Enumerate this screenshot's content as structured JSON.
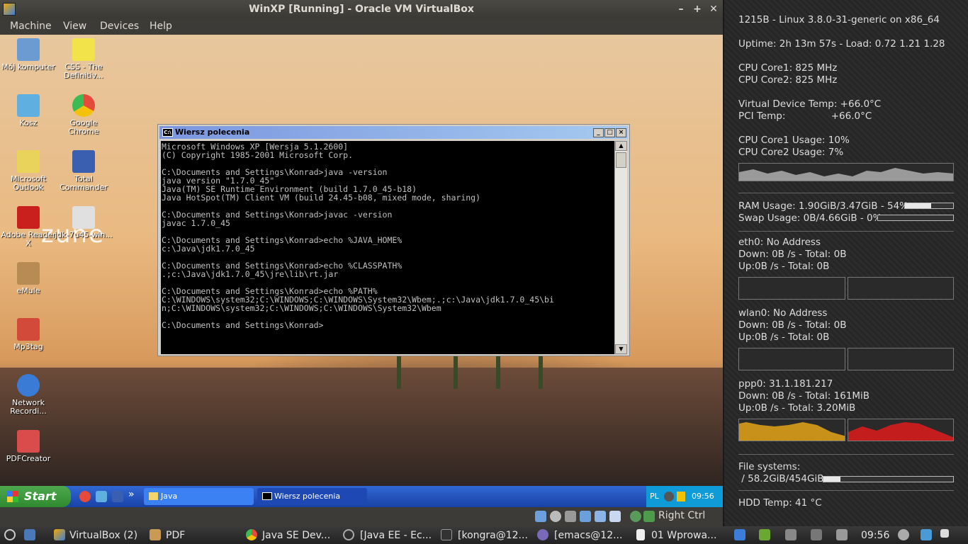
{
  "vbox": {
    "title": "WinXP [Running] - Oracle VM VirtualBox",
    "menu": [
      "Machine",
      "View",
      "Devices",
      "Help"
    ],
    "controls": {
      "minimize": "–",
      "maximize": "+",
      "close": "✕"
    },
    "status_hostkey": "Right Ctrl"
  },
  "guest": {
    "wallpaper_logo": "zune",
    "desktop_icons": [
      {
        "label": "Mój komputer",
        "icon": "my-computer-icon",
        "color": "#6c9bd2"
      },
      {
        "label": "CSS - The Definitiv...",
        "icon": "help-file-icon",
        "color": "#f2e34b"
      },
      {
        "label": "Kosz",
        "icon": "recycle-bin-icon",
        "color": "#5fb0e0"
      },
      {
        "label": "Google Chrome",
        "icon": "chrome-icon",
        "color": "#e64a3b"
      },
      {
        "label": "Microsoft Outlook",
        "icon": "outlook-icon",
        "color": "#e9d35a"
      },
      {
        "label": "Total Commander",
        "icon": "floppy-icon",
        "color": "#3a5fb0"
      },
      {
        "label": "Adobe Reader X",
        "icon": "adobe-reader-icon",
        "color": "#c9201d"
      },
      {
        "label": "jdk-7u45-win...",
        "icon": "java-icon",
        "color": "#e0e0e0"
      },
      {
        "label": "eMule",
        "icon": "emule-icon",
        "color": "#b88a54"
      },
      {
        "label": "Mp3tag",
        "icon": "mp3tag-icon",
        "color": "#d24a3a"
      },
      {
        "label": "Network Recordi...",
        "icon": "network-recorder-icon",
        "color": "#3a7bd5"
      },
      {
        "label": "PDFCreator",
        "icon": "pdfcreator-icon",
        "color": "#d94c4c"
      }
    ],
    "cmd": {
      "title": "Wiersz polecenia",
      "icon_text": "C:\\",
      "lines": [
        "Microsoft Windows XP [Wersja 5.1.2600]",
        "(C) Copyright 1985-2001 Microsoft Corp.",
        "",
        "C:\\Documents and Settings\\Konrad>java -version",
        "java version \"1.7.0_45\"",
        "Java(TM) SE Runtime Environment (build 1.7.0_45-b18)",
        "Java HotSpot(TM) Client VM (build 24.45-b08, mixed mode, sharing)",
        "",
        "C:\\Documents and Settings\\Konrad>javac -version",
        "javac 1.7.0_45",
        "",
        "C:\\Documents and Settings\\Konrad>echo %JAVA_HOME%",
        "c:\\Java\\jdk1.7.0_45",
        "",
        "C:\\Documents and Settings\\Konrad>echo %CLASSPATH%",
        ".;c:\\Java\\jdk1.7.0_45\\jre\\lib\\rt.jar",
        "",
        "C:\\Documents and Settings\\Konrad>echo %PATH%",
        "C:\\WINDOWS\\system32;C:\\WINDOWS;C:\\WINDOWS\\System32\\Wbem;.;c:\\Java\\jdk1.7.0_45\\bi",
        "n;C:\\WINDOWS\\system32;C:\\WINDOWS;C:\\WINDOWS\\System32\\Wbem",
        "",
        "C:\\Documents and Settings\\Konrad>"
      ]
    },
    "taskbar": {
      "start": "Start",
      "overflow": "»",
      "tasks": [
        "Java",
        "Wiersz polecenia"
      ],
      "language": "PL",
      "clock": "09:56"
    }
  },
  "conky": {
    "system": "1215B - Linux 3.8.0-31-generic on x86_64",
    "uptime": "Uptime: 2h 13m 57s - Load: 0.72 1.21 1.28",
    "cpu_freq": [
      "CPU Core1: 825 MHz",
      "CPU Core2: 825 MHz"
    ],
    "temps": [
      "Virtual Device Temp: +66.0°C",
      "PCI Temp:               +66.0°C"
    ],
    "cpu_usage": [
      "CPU Core1 Usage: 10%",
      "CPU Core2 Usage: 7%"
    ],
    "ram": {
      "label": "RAM Usage: 1.90GiB/3.47GiB - 54%",
      "percent": 54
    },
    "swap": {
      "label": "Swap Usage: 0B/4.66GiB - 0%",
      "percent": 0
    },
    "eth0": [
      "eth0: No Address",
      "Down: 0B /s - Total: 0B",
      "Up:0B /s - Total: 0B"
    ],
    "wlan0": [
      "wlan0: No Address",
      "Down: 0B /s - Total: 0B",
      "Up:0B /s - Total: 0B"
    ],
    "ppp0": [
      "ppp0: 31.1.181.217",
      "Down: 0B /s - Total: 161MiB",
      "Up:0B /s - Total: 3.20MiB"
    ],
    "fs": {
      "title": "File systems:",
      "root": " / 58.2GiB/454GiB",
      "percent": 13
    },
    "hdd": "HDD Temp: 41 °C",
    "colors": {
      "down_graph": "#c8921a",
      "up_graph": "#c41d1d",
      "cpu_graph": "#cfcfcf"
    }
  },
  "host_taskbar": {
    "tasks": [
      {
        "label": "VirtualBox (2)",
        "icon": "virtualbox-icon"
      },
      {
        "label": "PDF",
        "icon": "folder-icon"
      },
      {
        "label": "Java SE Dev...",
        "icon": "chrome-icon"
      },
      {
        "label": "[Java EE - Ec...",
        "icon": "eclipse-icon"
      },
      {
        "label": "[kongra@12...",
        "icon": "terminal-icon"
      },
      {
        "label": "[emacs@12...",
        "icon": "emacs-icon"
      },
      {
        "label": "01 Wprowa...",
        "icon": "document-icon"
      }
    ],
    "clock": "09:56"
  }
}
